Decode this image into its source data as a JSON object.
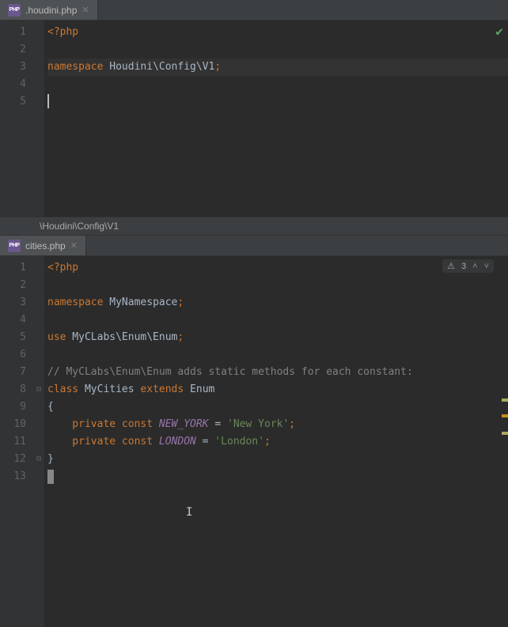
{
  "pane1": {
    "tab": {
      "filename": ".houdini.php"
    },
    "lines": {
      "l1": "<?php",
      "l3_kw": "namespace",
      "l3_ns": " Houdini\\Config\\V1",
      "l3_semi": ";"
    },
    "line_count": 5
  },
  "breadcrumb": "\\Houdini\\Config\\V1",
  "pane2": {
    "tab": {
      "filename": "cities.php"
    },
    "inspection": {
      "icon": "⚠",
      "count": "3"
    },
    "lines": {
      "l1": "<?php",
      "l3_kw": "namespace",
      "l3_ns": " MyNamespace",
      "l3_semi": ";",
      "l5_kw": "use",
      "l5_ns": " MyCLabs\\Enum\\Enum",
      "l5_semi": ";",
      "l7_cmt": "// MyCLabs\\Enum\\Enum adds static methods for each constant:",
      "l8_kw1": "class",
      "l8_cls": " MyCities ",
      "l8_kw2": "extends",
      "l8_sup": " Enum",
      "l9": "{",
      "l10_kw": "    private const ",
      "l10_c": "NEW_YORK",
      "l10_eq": " = ",
      "l10_str": "'New York'",
      "l10_semi": ";",
      "l11_kw": "    private const ",
      "l11_c": "LONDON",
      "l11_eq": " = ",
      "l11_str": "'London'",
      "l11_semi": ";",
      "l12": "}"
    },
    "line_count": 13
  }
}
